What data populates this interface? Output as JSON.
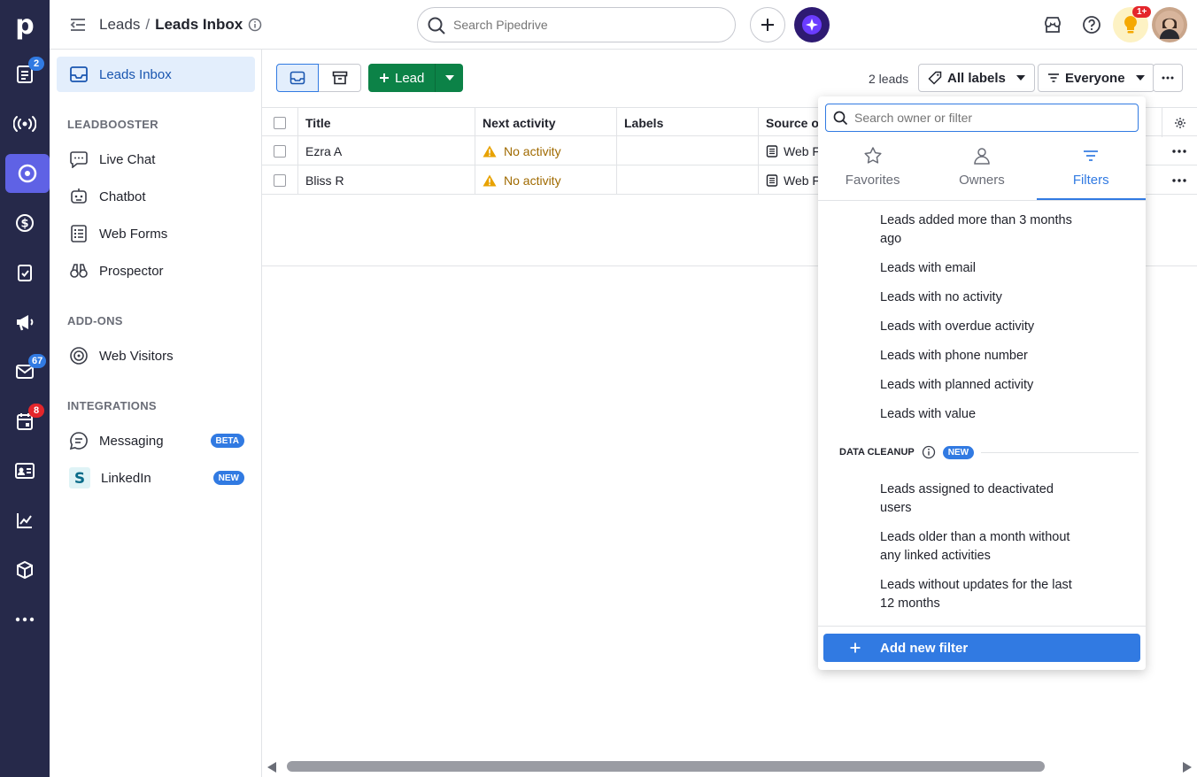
{
  "app": {
    "logo_letter": "p",
    "rail_badges": {
      "deals": "2",
      "mail": "67",
      "calendar": "8"
    }
  },
  "topbar": {
    "breadcrumb_parent": "Leads",
    "breadcrumb_sep": "/",
    "breadcrumb_current": "Leads Inbox",
    "search_placeholder": "Search Pipedrive",
    "notification_badge": "1+"
  },
  "sidebar": {
    "inbox": "Leads Inbox",
    "section_leadbooster": "LEADBOOSTER",
    "leadbooster_items": [
      "Live Chat",
      "Chatbot",
      "Web Forms",
      "Prospector"
    ],
    "section_addons": "ADD-ONS",
    "addon_items": [
      "Web Visitors"
    ],
    "section_integrations": "INTEGRATIONS",
    "integration_items": [
      {
        "label": "Messaging",
        "badge": "BETA"
      },
      {
        "label": "LinkedIn",
        "badge": "NEW"
      }
    ]
  },
  "toolbar": {
    "lead_label": "Lead",
    "count": "2 leads",
    "labels_btn": "All labels",
    "owner_btn": "Everyone"
  },
  "table": {
    "columns": [
      "Title",
      "Next activity",
      "Labels",
      "Source o"
    ],
    "rows": [
      {
        "title": "Ezra A",
        "activity": "No activity",
        "labels": "",
        "source": "Web F"
      },
      {
        "title": "Bliss R",
        "activity": "No activity",
        "labels": "",
        "source": "Web F"
      }
    ]
  },
  "filter_panel": {
    "search_placeholder": "Search owner or filter",
    "tabs": [
      "Favorites",
      "Owners",
      "Filters"
    ],
    "active_tab": "Filters",
    "filters": [
      "Leads added more than 3 months ago",
      "Leads with email",
      "Leads with no activity",
      "Leads with overdue activity",
      "Leads with phone number",
      "Leads with planned activity",
      "Leads with value"
    ],
    "cleanup_title": "DATA CLEANUP",
    "cleanup_badge": "NEW",
    "cleanup_filters": [
      "Leads assigned to deactivated users",
      "Leads older than a month without any linked activities",
      "Leads without updates for the last 12 months"
    ],
    "add_filter": "Add new filter"
  },
  "colors": {
    "rail_bg": "#26294a",
    "rail_active": "#5f62e5",
    "accent_blue": "#317ae2",
    "lead_green": "#0c8247",
    "warning": "#e8a200"
  }
}
